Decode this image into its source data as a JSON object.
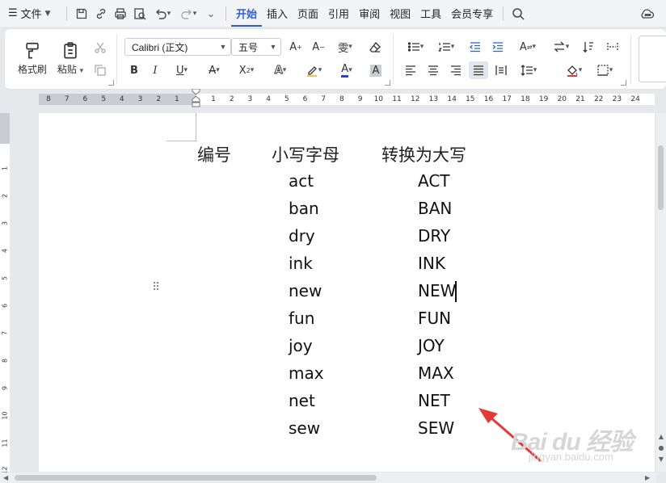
{
  "menu": {
    "file_label": "文件",
    "tabs": [
      "开始",
      "插入",
      "页面",
      "引用",
      "审阅",
      "视图",
      "工具",
      "会员专享"
    ]
  },
  "ribbon": {
    "format_painter": "格式刷",
    "paste": "粘贴",
    "font_name": "Calibri (正文)",
    "font_size": "五号"
  },
  "ruler": {
    "h_numbers_left": [
      "8",
      "7",
      "6",
      "5",
      "4",
      "3",
      "2",
      "1"
    ],
    "h_numbers_right": [
      "1",
      "2",
      "3",
      "4",
      "5",
      "6",
      "7",
      "8",
      "9",
      "10",
      "11",
      "12",
      "13",
      "14",
      "15",
      "16",
      "17",
      "18",
      "19",
      "20",
      "21",
      "22",
      "23",
      "24"
    ],
    "v_numbers": [
      "1",
      "2",
      "3",
      "4",
      "5",
      "6",
      "7",
      "8",
      "9",
      "10",
      "11",
      "12"
    ]
  },
  "document": {
    "headers": [
      "编号",
      "小写字母",
      "转换为大写"
    ],
    "rows": [
      {
        "lower": "act",
        "upper": "ACT"
      },
      {
        "lower": "ban",
        "upper": "BAN"
      },
      {
        "lower": "dry",
        "upper": "DRY"
      },
      {
        "lower": "ink",
        "upper": "INK"
      },
      {
        "lower": "new",
        "upper": "NEW"
      },
      {
        "lower": "fun",
        "upper": "FUN"
      },
      {
        "lower": "joy",
        "upper": "JOY"
      },
      {
        "lower": "max",
        "upper": "MAX"
      },
      {
        "lower": "net",
        "upper": "NET"
      },
      {
        "lower": "sew",
        "upper": "SEW"
      }
    ]
  },
  "watermark": {
    "line1": "Bai du 经验",
    "line2": "jingyan.baidu.com"
  },
  "colors": {
    "accent": "#2b5fd9",
    "annotation_arrow": "#e53935"
  }
}
